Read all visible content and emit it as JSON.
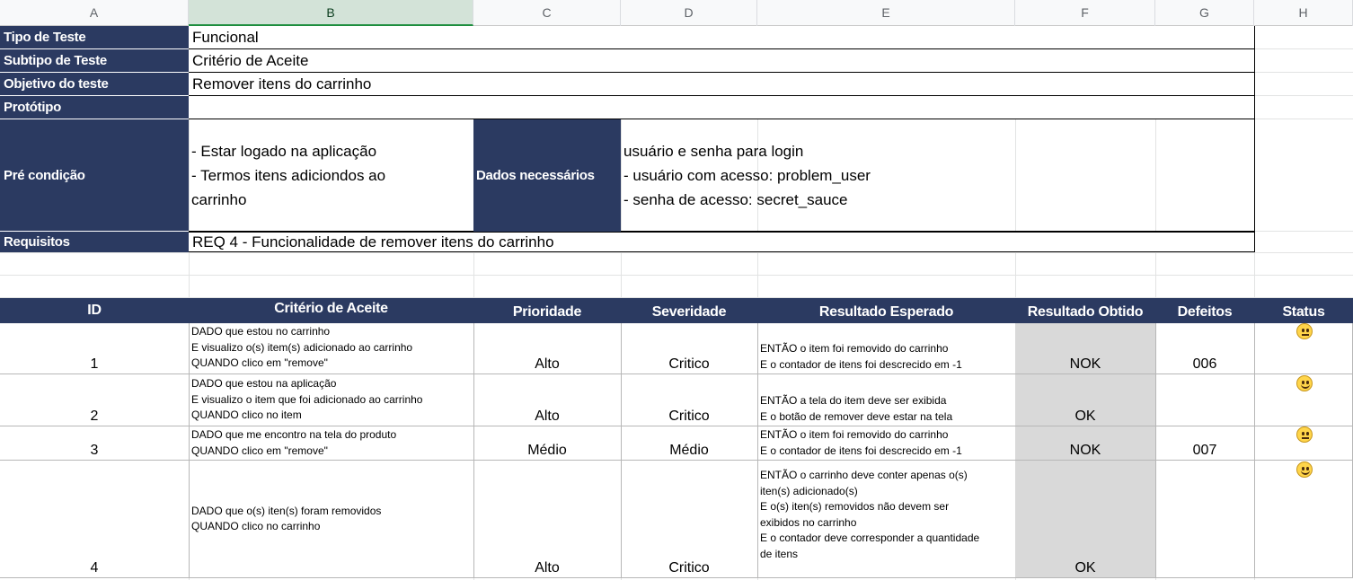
{
  "columns": [
    "A",
    "B",
    "C",
    "D",
    "E",
    "F",
    "G",
    "H"
  ],
  "info": {
    "tipo_label": "Tipo de Teste",
    "tipo_value": "Funcional",
    "subtipo_label": "Subtipo de Teste",
    "subtipo_value": "Critério de Aceite",
    "objetivo_label": "Objetivo do teste",
    "objetivo_value": "Remover itens do carrinho",
    "prototipo_label": "Protótipo",
    "prototipo_value": "",
    "pre_label": "Pré condição",
    "pre_lines": [
      "- Estar logado na aplicação",
      "- Termos itens adiciondos ao",
      "carrinho"
    ],
    "dados_label": "Dados necessários",
    "dados_lines": [
      "usuário e senha para login",
      "- usuário com acesso: problem_user",
      "- senha de acesso: secret_sauce"
    ],
    "req_label": "Requisitos",
    "req_value": "REQ 4 - Funcionalidade de remover itens do carrinho"
  },
  "table": {
    "headers": [
      "ID",
      "Critério de Aceite",
      "Prioridade",
      "Severidade",
      "Resultado Esperado",
      "Resultado Obtido",
      "Defeitos",
      "Status"
    ],
    "rows": [
      {
        "id": "1",
        "criterio": [
          "DADO que estou no carrinho",
          "E visualizo o(s) item(s) adicionado ao carrinho",
          "QUANDO clico em \"remove\""
        ],
        "prioridade": "Alto",
        "severidade": "Critico",
        "esperado": [
          "ENTÃO o item foi removido do carrinho",
          "E o contador de itens foi descrecido em -1"
        ],
        "obtido": "NOK",
        "defeitos": "006",
        "status_icon": "neutral-face-icon"
      },
      {
        "id": "2",
        "criterio": [
          "DADO que estou na aplicação",
          "E visualizo o item que foi adicionado ao carrinho",
          "QUANDO clico no item"
        ],
        "prioridade": "Alto",
        "severidade": "Critico",
        "esperado": [
          "ENTÃO a tela do item deve ser exibida",
          "E o botão de remover deve estar na tela"
        ],
        "obtido": "OK",
        "defeitos": "",
        "status_icon": "smiling-face-icon"
      },
      {
        "id": "3",
        "criterio": [
          "DADO que me encontro na tela do produto",
          "QUANDO clico em \"remove\""
        ],
        "prioridade": "Médio",
        "severidade": "Médio",
        "esperado": [
          "ENTÃO o item foi removido do carrinho",
          "E o contador de itens foi descrecido em -1"
        ],
        "obtido": "NOK",
        "defeitos": "007",
        "status_icon": "neutral-face-icon"
      },
      {
        "id": "4",
        "criterio": [
          "DADO que o(s) iten(s) foram removidos",
          "QUANDO clico no carrinho"
        ],
        "prioridade": "Alto",
        "severidade": "Critico",
        "esperado": [
          "ENTÃO o carrinho deve conter apenas o(s)",
          "iten(s) adicionado(s)",
          "E o(s) iten(s) removidos não devem ser",
          "exibidos no carrinho",
          "E o contador deve corresponder a quantidade",
          "de itens"
        ],
        "obtido": "OK",
        "defeitos": "",
        "status_icon": "smiling-face-icon"
      }
    ]
  }
}
